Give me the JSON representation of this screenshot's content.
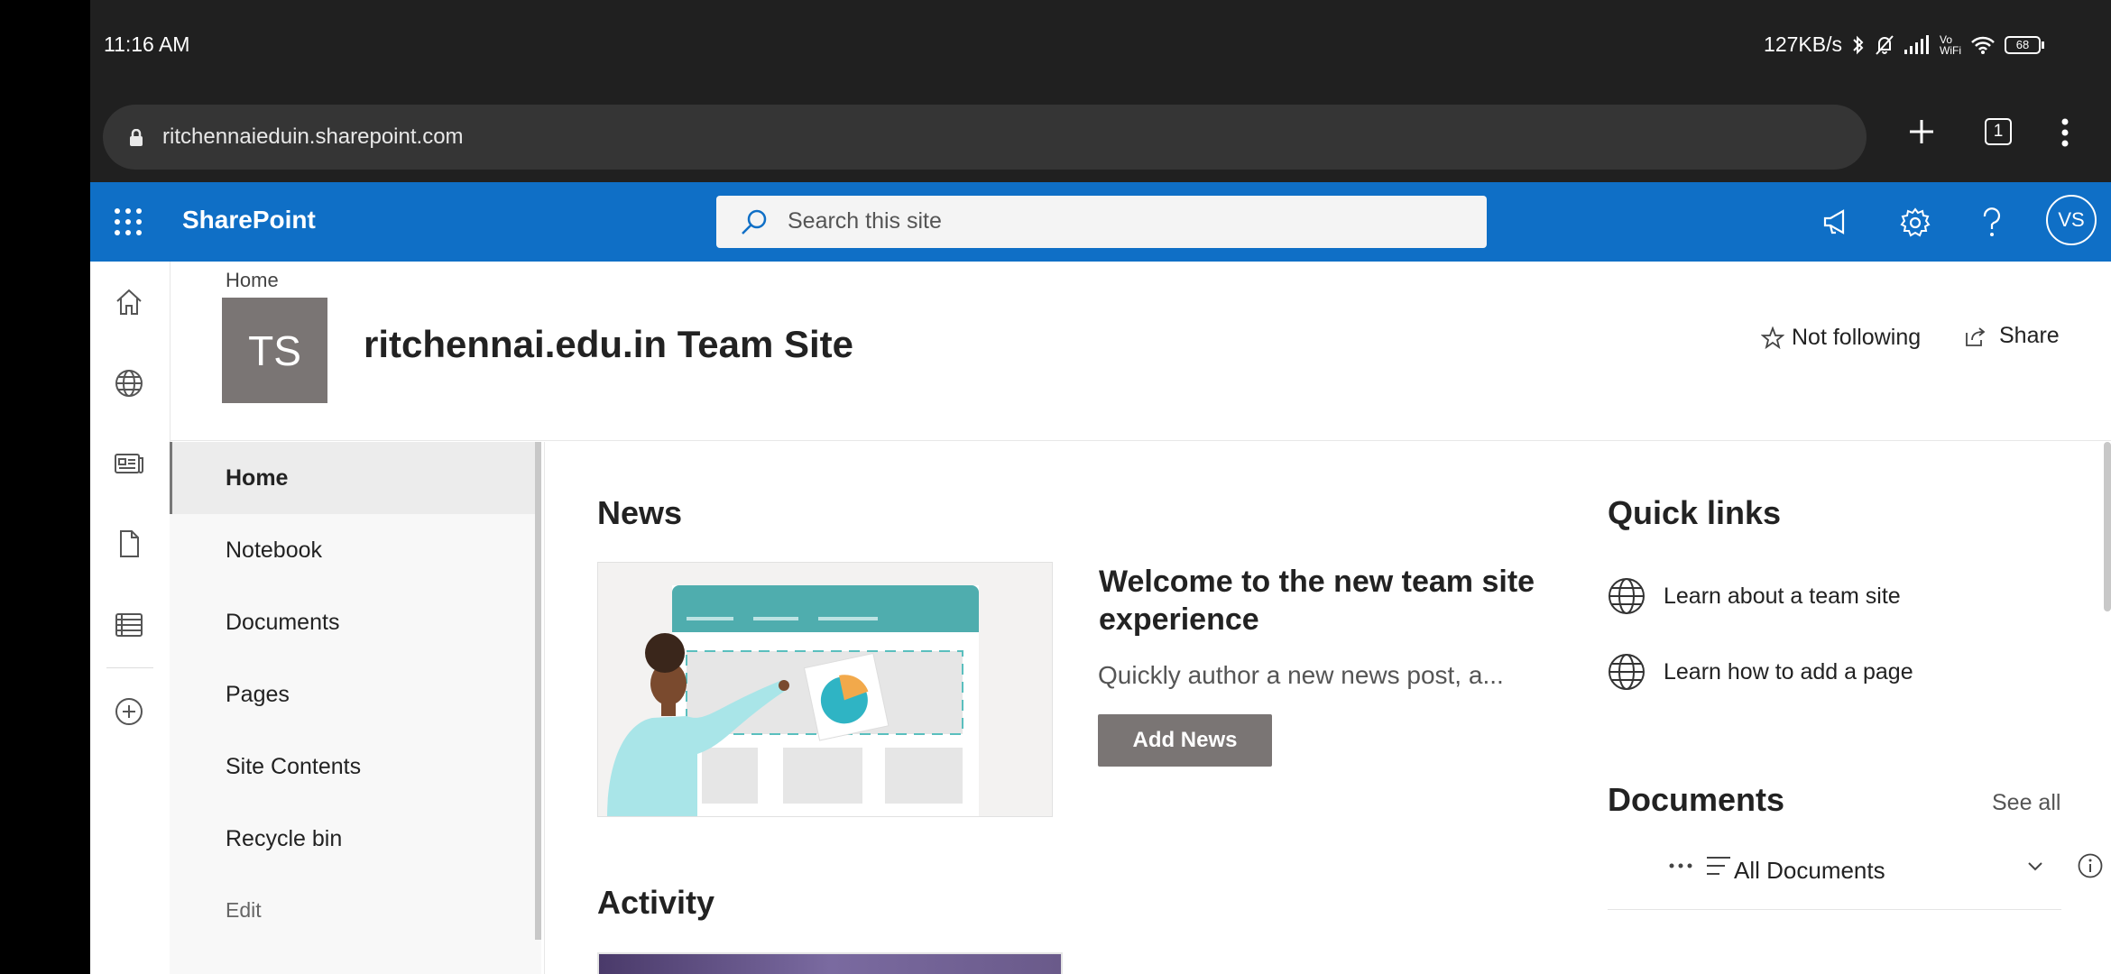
{
  "status_bar": {
    "time": "11:16 AM",
    "speed": "127KB/s",
    "battery": "68",
    "network_label": "Vo WiFi"
  },
  "browser": {
    "url": "ritchennaieduin.sharepoint.com",
    "tab_count": "1"
  },
  "header": {
    "brand": "SharePoint",
    "search_placeholder": "Search this site",
    "avatar_initials": "VS"
  },
  "site": {
    "breadcrumb": "Home",
    "logo_text": "TS",
    "title": "ritchennai.edu.in Team Site",
    "follow_label": "Not following",
    "share_label": "Share"
  },
  "nav": {
    "items": [
      {
        "label": "Home"
      },
      {
        "label": "Notebook"
      },
      {
        "label": "Documents"
      },
      {
        "label": "Pages"
      },
      {
        "label": "Site Contents"
      },
      {
        "label": "Recycle bin"
      },
      {
        "label": "Edit"
      }
    ]
  },
  "news": {
    "heading": "News",
    "title": "Welcome to the new team site experience",
    "description": "Quickly author a new news post, a...",
    "button": "Add News"
  },
  "activity": {
    "heading": "Activity"
  },
  "quick_links": {
    "heading": "Quick links",
    "items": [
      {
        "label": "Learn about a team site"
      },
      {
        "label": "Learn how to add a page"
      }
    ]
  },
  "documents": {
    "heading": "Documents",
    "see_all": "See all",
    "view": "All Documents"
  },
  "colors": {
    "suite_bar": "#0f6fc6",
    "status_bar": "#202020",
    "logo_bg": "#7a7574",
    "button_bg": "#7a7574"
  }
}
